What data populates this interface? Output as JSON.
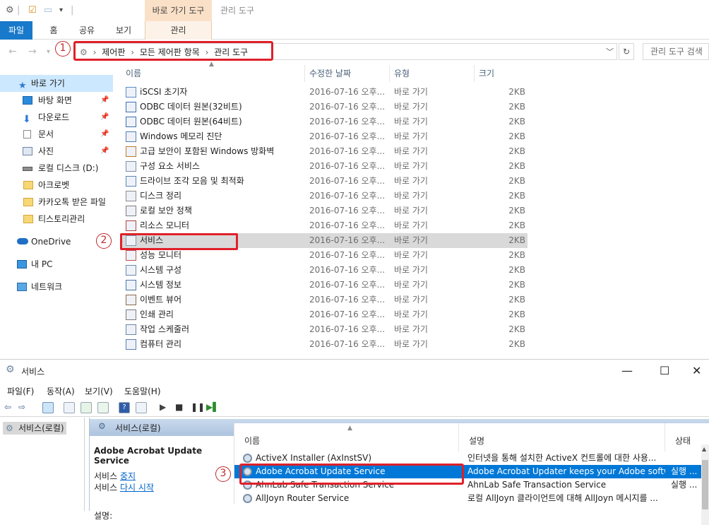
{
  "explorer": {
    "context_tab_group": "바로 가기 도구",
    "context_inactive": "관리 도구",
    "ribbon_tabs": [
      "파일",
      "홈",
      "공유",
      "보기",
      "관리"
    ],
    "breadcrumbs": [
      "제어판",
      "모든 제어판 항목",
      "관리 도구"
    ],
    "search_placeholder": "관리 도구 검색",
    "callouts": [
      "1",
      "2",
      "3"
    ],
    "nav": [
      {
        "label": "바로 가기",
        "icon": "star-icon"
      },
      {
        "label": "바탕 화면",
        "icon": "desktop-icon"
      },
      {
        "label": "다운로드",
        "icon": "download-icon"
      },
      {
        "label": "문서",
        "icon": "document-icon"
      },
      {
        "label": "사진",
        "icon": "picture-icon"
      },
      {
        "label": "로컬 디스크 (D:)",
        "icon": "drive-icon"
      },
      {
        "label": "아크로벳",
        "icon": "folder-icon"
      },
      {
        "label": "카카오톡 받은 파일",
        "icon": "folder-icon"
      },
      {
        "label": "티스토리관리",
        "icon": "folder-icon"
      },
      {
        "label": "OneDrive",
        "icon": "cloud-icon"
      },
      {
        "label": "내 PC",
        "icon": "computer-icon"
      },
      {
        "label": "네트워크",
        "icon": "network-icon"
      }
    ],
    "columns": [
      "이름",
      "수정한 날짜",
      "유형",
      "크기"
    ],
    "files": [
      {
        "name": "iSCSI 초기자",
        "date": "2016-07-16 오후...",
        "type": "바로 가기",
        "size": "2KB"
      },
      {
        "name": "ODBC 데이터 원본(32비트)",
        "date": "2016-07-16 오후...",
        "type": "바로 가기",
        "size": "2KB"
      },
      {
        "name": "ODBC 데이터 원본(64비트)",
        "date": "2016-07-16 오후...",
        "type": "바로 가기",
        "size": "2KB"
      },
      {
        "name": "Windows 메모리 진단",
        "date": "2016-07-16 오후...",
        "type": "바로 가기",
        "size": "2KB"
      },
      {
        "name": "고급 보안이 포함된 Windows 방화벽",
        "date": "2016-07-16 오후...",
        "type": "바로 가기",
        "size": "2KB"
      },
      {
        "name": "구성 요소 서비스",
        "date": "2016-07-16 오후...",
        "type": "바로 가기",
        "size": "2KB"
      },
      {
        "name": "드라이브 조각 모음 및 최적화",
        "date": "2016-07-16 오후...",
        "type": "바로 가기",
        "size": "2KB"
      },
      {
        "name": "디스크 정리",
        "date": "2016-07-16 오후...",
        "type": "바로 가기",
        "size": "2KB"
      },
      {
        "name": "로컬 보안 정책",
        "date": "2016-07-16 오후...",
        "type": "바로 가기",
        "size": "2KB"
      },
      {
        "name": "리소스 모니터",
        "date": "2016-07-16 오후...",
        "type": "바로 가기",
        "size": "2KB"
      },
      {
        "name": "서비스",
        "date": "2016-07-16 오후...",
        "type": "바로 가기",
        "size": "2KB"
      },
      {
        "name": "성능 모니터",
        "date": "2016-07-16 오후...",
        "type": "바로 가기",
        "size": "2KB"
      },
      {
        "name": "시스템 구성",
        "date": "2016-07-16 오후...",
        "type": "바로 가기",
        "size": "2KB"
      },
      {
        "name": "시스템 정보",
        "date": "2016-07-16 오후...",
        "type": "바로 가기",
        "size": "2KB"
      },
      {
        "name": "이벤트 뷰어",
        "date": "2016-07-16 오후...",
        "type": "바로 가기",
        "size": "2KB"
      },
      {
        "name": "인쇄 관리",
        "date": "2016-07-16 오후...",
        "type": "바로 가기",
        "size": "2KB"
      },
      {
        "name": "작업 스케줄러",
        "date": "2016-07-16 오후...",
        "type": "바로 가기",
        "size": "2KB"
      },
      {
        "name": "컴퓨터 관리",
        "date": "2016-07-16 오후...",
        "type": "바로 가기",
        "size": "2KB"
      }
    ]
  },
  "services": {
    "title": "서비스",
    "menu": [
      "파일(F)",
      "동작(A)",
      "보기(V)",
      "도움말(H)"
    ],
    "tree_node": "서비스(로컬)",
    "panel_header": "서비스(로컬)",
    "selected_title": "Adobe Acrobat Update Service",
    "stop_prefix": "서비스 ",
    "stop_link": "중지",
    "restart_prefix": "서비스 ",
    "restart_link": "다시 시작",
    "desc_label": "설명:",
    "columns": [
      "이름",
      "설명",
      "상태"
    ],
    "rows": [
      {
        "name": "ActiveX Installer (AxInstSV)",
        "desc": "인터넷을 통해 설치한 ActiveX 컨트롤에 대한 사용...",
        "state": ""
      },
      {
        "name": "Adobe Acrobat Update Service",
        "desc": "Adobe Acrobat Updater keeps your Adobe softwa...",
        "state": "실행 ..."
      },
      {
        "name": "AhnLab Safe Transaction Service",
        "desc": "AhnLab Safe Transaction Service",
        "state": "실행 ..."
      },
      {
        "name": "AllJoyn Router Service",
        "desc": "로컬 AllJoyn 클라이언트에 대해 AllJoyn 메시지를 ...",
        "state": ""
      }
    ]
  }
}
